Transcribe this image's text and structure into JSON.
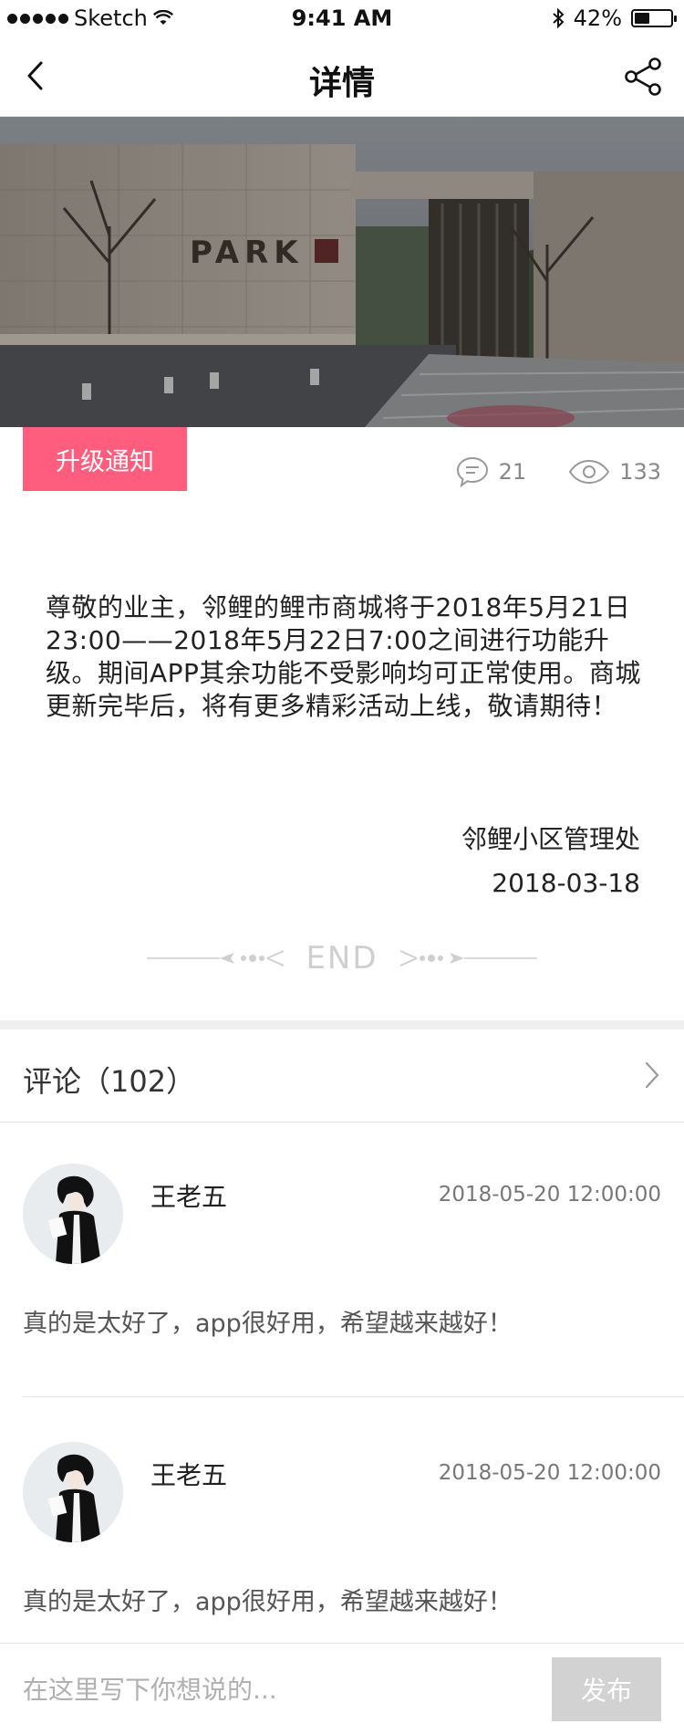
{
  "status_bar": {
    "carrier": "Sketch",
    "time": "9:41 AM",
    "battery": "42%",
    "battery_level": 0.42
  },
  "nav": {
    "title": "详情"
  },
  "hero": {
    "sign_text": "PARK"
  },
  "article": {
    "tag": "升级通知",
    "comment_count": "21",
    "view_count": "133",
    "body": "尊敬的业主，邻鲤的鲤市商城将于2018年5月21日23:00——2018年5月22日7:00之间进行功能升级。期间APP其余功能不受影响均可正常使用。商城更新完毕后，将有更多精彩活动上线，敬请期待！",
    "signature": "邻鲤小区管理处",
    "date": "2018-03-18",
    "end_text": "END"
  },
  "comments": {
    "title": "评论（102）",
    "items": [
      {
        "author": "王老五",
        "time": "2018-05-20  12:00:00",
        "text": "真的是太好了，app很好用，希望越来越好！"
      },
      {
        "author": "王老五",
        "time": "2018-05-20  12:00:00",
        "text": "真的是太好了，app很好用，希望越来越好！"
      }
    ]
  },
  "input": {
    "placeholder": "在这里写下你想说的...",
    "publish_label": "发布"
  },
  "colors": {
    "accent": "#ff5d7d",
    "button_disabled": "#d2d2d2"
  }
}
